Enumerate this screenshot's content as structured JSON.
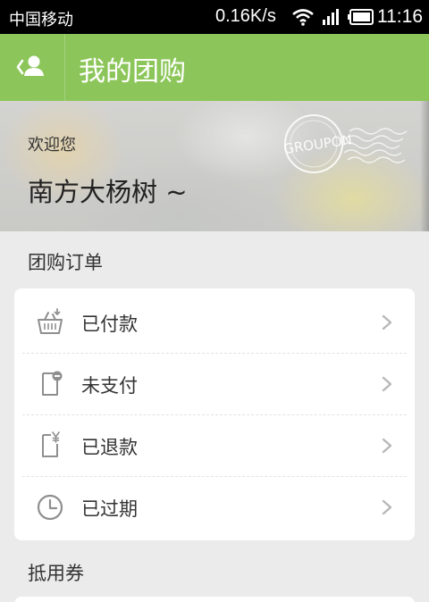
{
  "status_bar": {
    "carrier": "中国移动",
    "net_speed": "0.16K/s",
    "time": "11:16"
  },
  "header": {
    "title": "我的团购"
  },
  "banner": {
    "welcome": "欢迎您",
    "username": "南方大杨树 ~",
    "stamp_text": "GROUPON"
  },
  "orders": {
    "heading": "团购订单",
    "items": [
      {
        "label": "已付款",
        "icon": "basket-icon"
      },
      {
        "label": "未支付",
        "icon": "document-minus-icon"
      },
      {
        "label": "已退款",
        "icon": "document-yen-icon"
      },
      {
        "label": "已过期",
        "icon": "clock-icon"
      }
    ]
  },
  "coupons": {
    "heading": "抵用券"
  },
  "colors": {
    "header_green": "#8cc65a",
    "background": "#ebebeb",
    "icon_gray": "#8f8f8f"
  }
}
